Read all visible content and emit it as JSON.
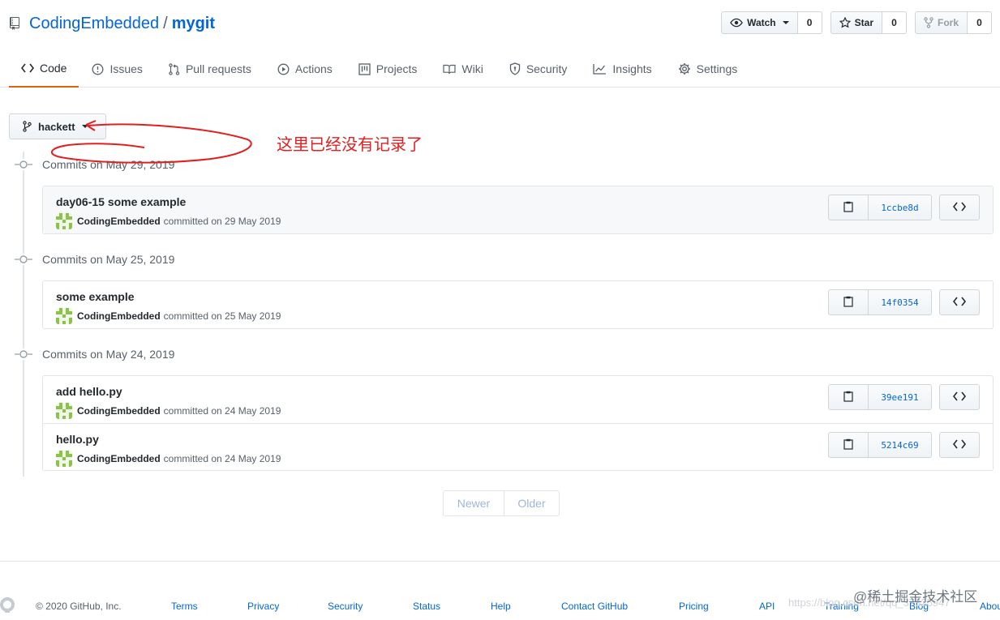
{
  "repo": {
    "owner": "CodingEmbedded",
    "separator": "/",
    "name": "mygit"
  },
  "actions": [
    {
      "label": "Watch",
      "count": "0",
      "icon": "eye-icon",
      "dropdown": true,
      "disabled": false
    },
    {
      "label": "Star",
      "count": "0",
      "icon": "star-icon",
      "dropdown": false,
      "disabled": false
    },
    {
      "label": "Fork",
      "count": "0",
      "icon": "fork-icon",
      "dropdown": false,
      "disabled": true
    }
  ],
  "nav": [
    {
      "label": "Code",
      "icon": "code-icon",
      "selected": true
    },
    {
      "label": "Issues",
      "icon": "issue-icon"
    },
    {
      "label": "Pull requests",
      "icon": "pull-request-icon"
    },
    {
      "label": "Actions",
      "icon": "play-icon"
    },
    {
      "label": "Projects",
      "icon": "project-icon"
    },
    {
      "label": "Wiki",
      "icon": "book-icon"
    },
    {
      "label": "Security",
      "icon": "shield-icon"
    },
    {
      "label": "Insights",
      "icon": "graph-icon"
    },
    {
      "label": "Settings",
      "icon": "gear-icon"
    }
  ],
  "branch": {
    "name": "hackett"
  },
  "groups": [
    {
      "title": "Commits on May 29, 2019",
      "commits": [
        {
          "message": "day06-15 some example",
          "author": "CodingEmbedded",
          "date": "committed on 29 May 2019",
          "sha": "1ccbe8d"
        }
      ]
    },
    {
      "title": "Commits on May 25, 2019",
      "commits": [
        {
          "message": "some example",
          "author": "CodingEmbedded",
          "date": "committed on 25 May 2019",
          "sha": "14f0354"
        }
      ]
    },
    {
      "title": "Commits on May 24, 2019",
      "commits": [
        {
          "message": "add hello.py",
          "author": "CodingEmbedded",
          "date": "committed on 24 May 2019",
          "sha": "39ee191"
        },
        {
          "message": "hello.py",
          "author": "CodingEmbedded",
          "date": "committed on 24 May 2019",
          "sha": "5214c69"
        }
      ]
    }
  ],
  "pagination": {
    "newer": "Newer",
    "older": "Older"
  },
  "footer": {
    "copyright": "© 2020 GitHub, Inc.",
    "links": [
      "Terms",
      "Privacy",
      "Security",
      "Status",
      "Help",
      "Contact GitHub",
      "Pricing",
      "API",
      "Training",
      "Blog",
      "About"
    ]
  },
  "annotation": {
    "text": "这里已经没有记录了"
  },
  "watermark": {
    "url": "https://blog.csdn.net/qq_37325947",
    "logo": "@稀土掘金技术社区"
  },
  "colors": {
    "link": "#0366d6",
    "accent_underline": "#e36209",
    "annotation": "#e02020",
    "avatar": "#8bc34a"
  }
}
